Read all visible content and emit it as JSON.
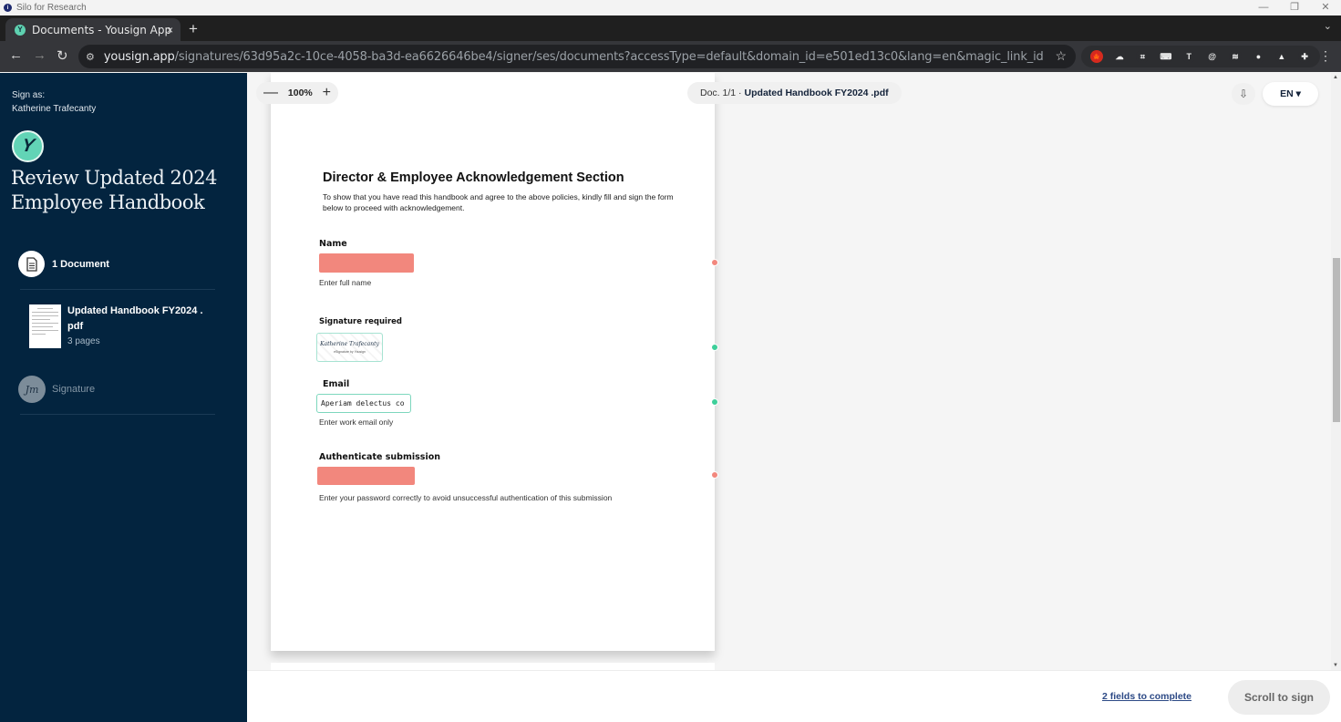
{
  "os": {
    "app_title": "Silo for Research",
    "minimize": "—",
    "maximize": "❐",
    "close": "✕"
  },
  "browser": {
    "tab_title": "Documents - Yousign App",
    "tab_close": "×",
    "new_tab": "+",
    "tab_menu": "⌄",
    "url_host": "yousign.app",
    "url_path": "/signatures/63d95a2c-10ce-4058-ba3d-ea6626646be4/signer/ses/documents?accessType=default&domain_id=e501ed13c0&lang=en&magic_link_id=ed0e6c7c-868c-45a...",
    "extensions": [
      {
        "name": "canada-flag-icon",
        "glyph": "🍁",
        "color": "#d52b1e"
      },
      {
        "name": "cloud-icon",
        "glyph": "☁",
        "color": "#2c2d30"
      },
      {
        "name": "crop-icon",
        "glyph": "⌗",
        "color": "#2c2d30"
      },
      {
        "name": "keyboard-icon",
        "glyph": "⌨",
        "color": "#2c2d30"
      },
      {
        "name": "text-t-icon",
        "glyph": "T",
        "color": "#2c2d30"
      },
      {
        "name": "at-sign-icon",
        "glyph": "@",
        "color": "#2c2d30"
      },
      {
        "name": "layers-icon",
        "glyph": "≋",
        "color": "#2c2d30"
      },
      {
        "name": "profile-ext-icon",
        "glyph": "●",
        "color": "#2c2d30"
      },
      {
        "name": "arrow-ext-icon",
        "glyph": "▲",
        "color": "#2c2d30"
      },
      {
        "name": "puzzle-icon",
        "glyph": "✚",
        "color": "#2c2d30"
      }
    ]
  },
  "sidebar": {
    "sign_as_label": "Sign as:",
    "signer_name": "Katherine Trafecanty",
    "logo_glyph": "Y",
    "title": "Review Updated 2024 Employee Handbook",
    "documents_label": "1 Document",
    "document": {
      "name": "Updated Handbook FY2024 . pdf",
      "pages": "3 pages"
    },
    "signature_icon_text": "Jm",
    "signature_label": "Signature"
  },
  "viewer": {
    "zoom_out": "—",
    "zoom_level": "100%",
    "zoom_in": "+",
    "doc_prefix": "Doc. 1/1 ·",
    "doc_name": "Updated Handbook FY2024 .pdf",
    "download_icon": "⇩",
    "language": "EN ▾"
  },
  "page": {
    "title": "Director & Employee Acknowledgement Section",
    "intro": "To show that you have read this handbook and agree to the above policies, kindly fill and sign the form below to proceed with acknowledgement.",
    "fields": {
      "name": {
        "label": "Name",
        "help": "Enter full name",
        "status": "incomplete"
      },
      "signature": {
        "label": "Signature required",
        "signed_name": "Katherine Trafecanty",
        "signed_sub": "eSignature by Yousign",
        "status": "complete"
      },
      "email": {
        "label": "Email",
        "value": "Aperiam delectus co",
        "help": "Enter work email only",
        "status": "complete"
      },
      "auth": {
        "label": "Authenticate submission",
        "help": "Enter your password correctly to avoid unsuccessful authentication of this submission",
        "status": "incomplete"
      }
    }
  },
  "colors": {
    "incomplete": "#f2877d",
    "complete": "#3ecf9a",
    "sidebar_bg": "#03243f",
    "accent": "#62d4b6"
  },
  "footer": {
    "fields_remaining": "2 fields to complete",
    "scroll_button": "Scroll to sign"
  }
}
